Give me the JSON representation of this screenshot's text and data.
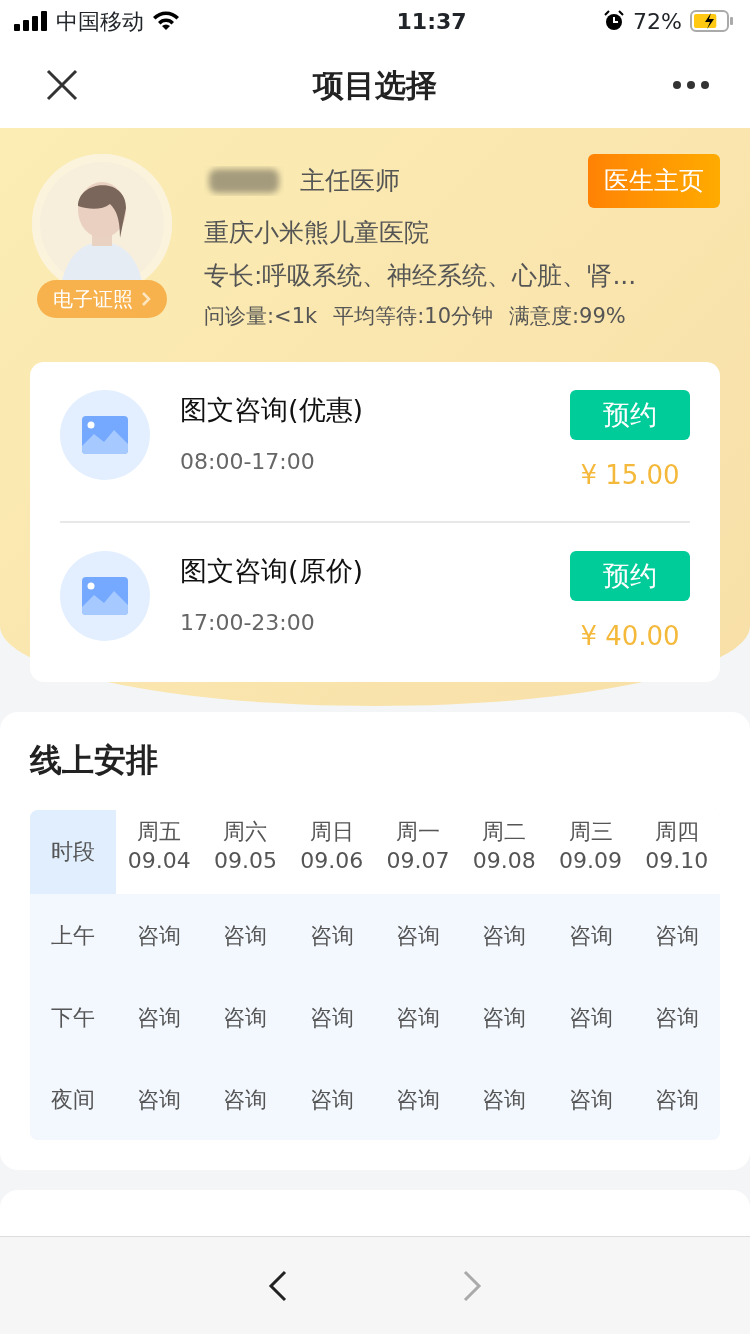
{
  "status_bar": {
    "carrier": "中国移动",
    "time": "11:37",
    "battery": "72%",
    "charging": true
  },
  "nav": {
    "title": "项目选择"
  },
  "doctor": {
    "title": "主任医师",
    "hospital": "重庆小米熊儿童医院",
    "specialty": "专长:呼吸系统、神经系统、心脏、肾...",
    "stats": [
      "问诊量:<1k",
      "平均等待:10分钟",
      "满意度:99%"
    ],
    "license": "电子证照",
    "home_button": "医生主页"
  },
  "services": [
    {
      "name": "图文咨询(优惠)",
      "hours": "08:00-17:00",
      "button": "预约",
      "price": "¥ 15.00"
    },
    {
      "name": "图文咨询(原价)",
      "hours": "17:00-23:00",
      "button": "预约",
      "price": "¥ 40.00"
    }
  ],
  "schedule": {
    "title": "线上安排",
    "corner": "时段",
    "days": [
      {
        "weekday": "周五",
        "date": "09.04"
      },
      {
        "weekday": "周六",
        "date": "09.05"
      },
      {
        "weekday": "周日",
        "date": "09.06"
      },
      {
        "weekday": "周一",
        "date": "09.07"
      },
      {
        "weekday": "周二",
        "date": "09.08"
      },
      {
        "weekday": "周三",
        "date": "09.09"
      },
      {
        "weekday": "周四",
        "date": "09.10"
      }
    ],
    "rows": [
      {
        "period": "上午",
        "cells": [
          "咨询",
          "咨询",
          "咨询",
          "咨询",
          "咨询",
          "咨询",
          "咨询"
        ]
      },
      {
        "period": "下午",
        "cells": [
          "咨询",
          "咨询",
          "咨询",
          "咨询",
          "咨询",
          "咨询",
          "咨询"
        ]
      },
      {
        "period": "夜间",
        "cells": [
          "咨询",
          "咨询",
          "咨询",
          "咨询",
          "咨询",
          "咨询",
          "咨询"
        ]
      }
    ]
  },
  "toolbar": [
    {
      "kind": "back",
      "disabled": false
    },
    {
      "kind": "forward",
      "disabled": true
    }
  ]
}
